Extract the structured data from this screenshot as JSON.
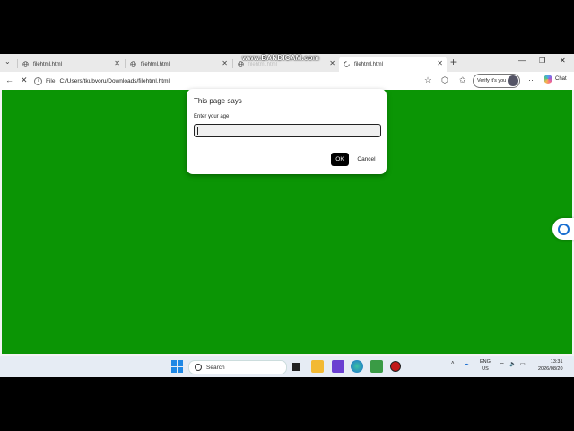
{
  "watermark": "www.BANDICAM.com",
  "tabs": [
    {
      "label": "filehtml.html",
      "active": false
    },
    {
      "label": "filehtml.html",
      "active": false
    },
    {
      "label": "filehtml.html",
      "active": false
    },
    {
      "label": "filehtml.html",
      "active": true
    }
  ],
  "address": {
    "scheme": "File",
    "url": "C:/Users/tkubvoru/Downloads/filehtml.html"
  },
  "toolbar": {
    "verify_label": "Verify it's you",
    "chat_label": "Chat"
  },
  "content": {
    "background": "#0b9505"
  },
  "dialog": {
    "title": "This page says",
    "message": "Enter your age",
    "input_value": "",
    "ok_label": "OK",
    "cancel_label": "Cancel"
  },
  "taskbar": {
    "search_placeholder": "Search",
    "language": "ENG",
    "region": "US",
    "time": "13:31",
    "date": "2026/08/20"
  },
  "icons": [
    "globe-icon",
    "loading-icon",
    "back-icon",
    "reload-icon",
    "star-icon",
    "extensions-icon",
    "favorites-icon",
    "more-icon",
    "windows-start-icon",
    "search-icon"
  ]
}
